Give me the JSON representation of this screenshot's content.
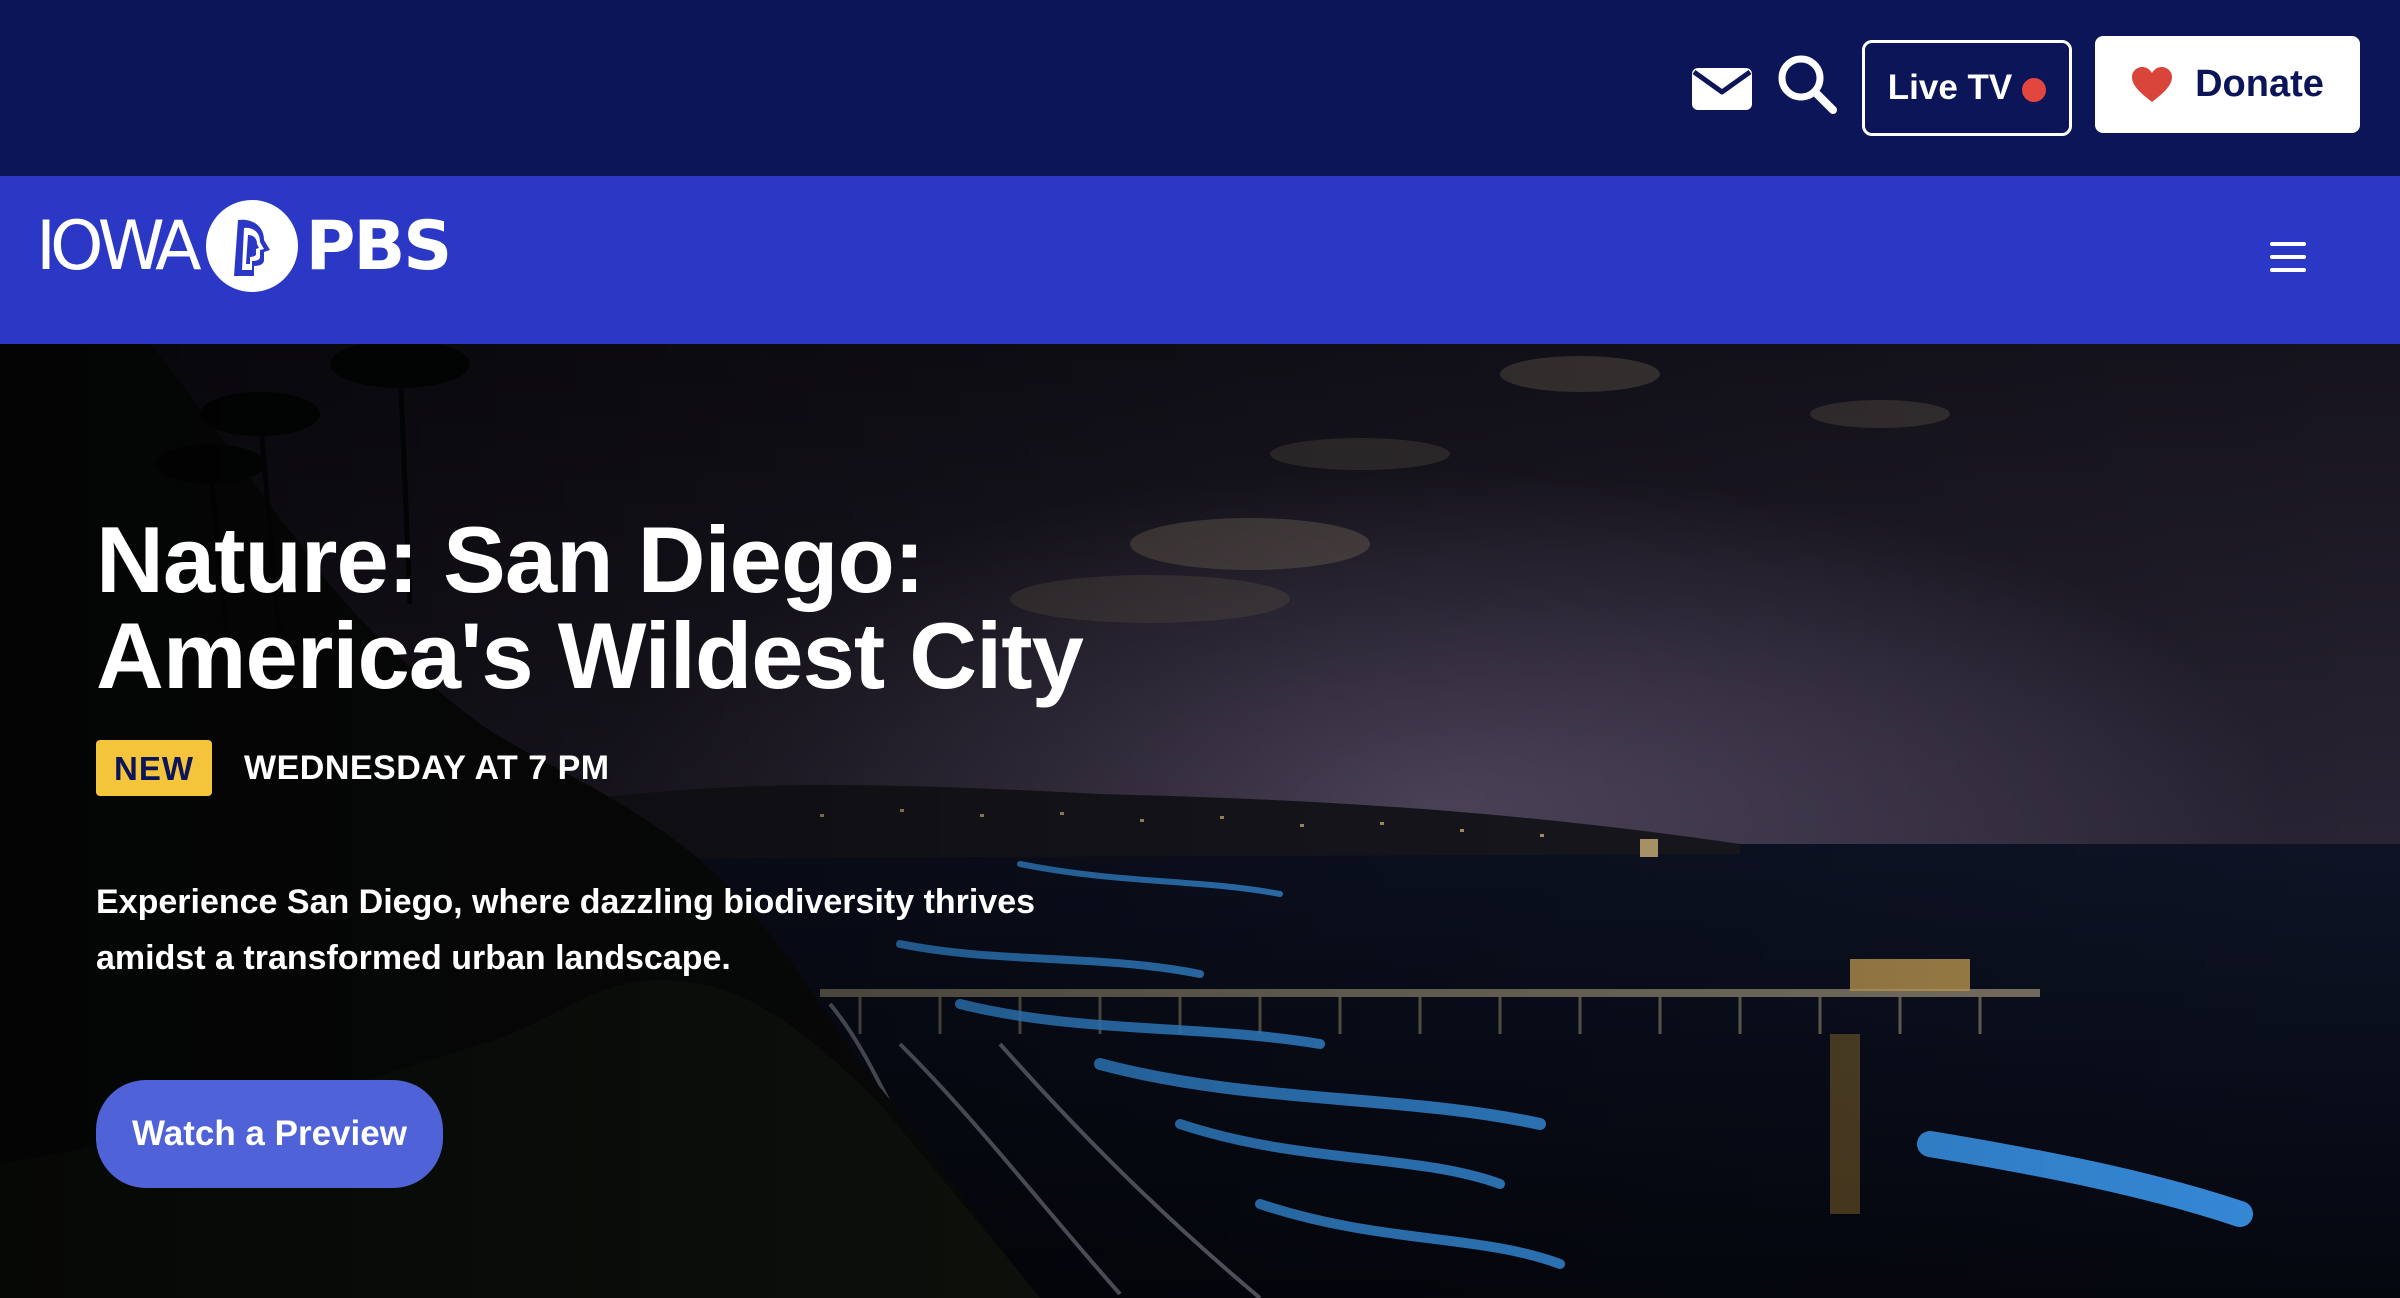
{
  "header": {
    "icons": {
      "mail": "envelope-icon",
      "search": "magnifier-icon"
    },
    "live_tv_label": "Live TV",
    "donate_label": "Donate"
  },
  "nav": {
    "logo_left": "IOWA",
    "logo_right": "PBS",
    "menu_icon": "hamburger-icon"
  },
  "hero": {
    "title": "Nature: San Diego: America's Wildest City",
    "badge": "NEW",
    "airtime": "WEDNESDAY AT 7 PM",
    "description": "Experience San Diego, where dazzling biodiversity thrives amidst a transformed urban landscape.",
    "cta_label": "Watch a Preview"
  },
  "colors": {
    "topbar": "#0c1558",
    "navbar": "#2b38c6",
    "badge": "#f4c43b",
    "cta": "#4f62d8",
    "live_dot": "#e2463e"
  }
}
